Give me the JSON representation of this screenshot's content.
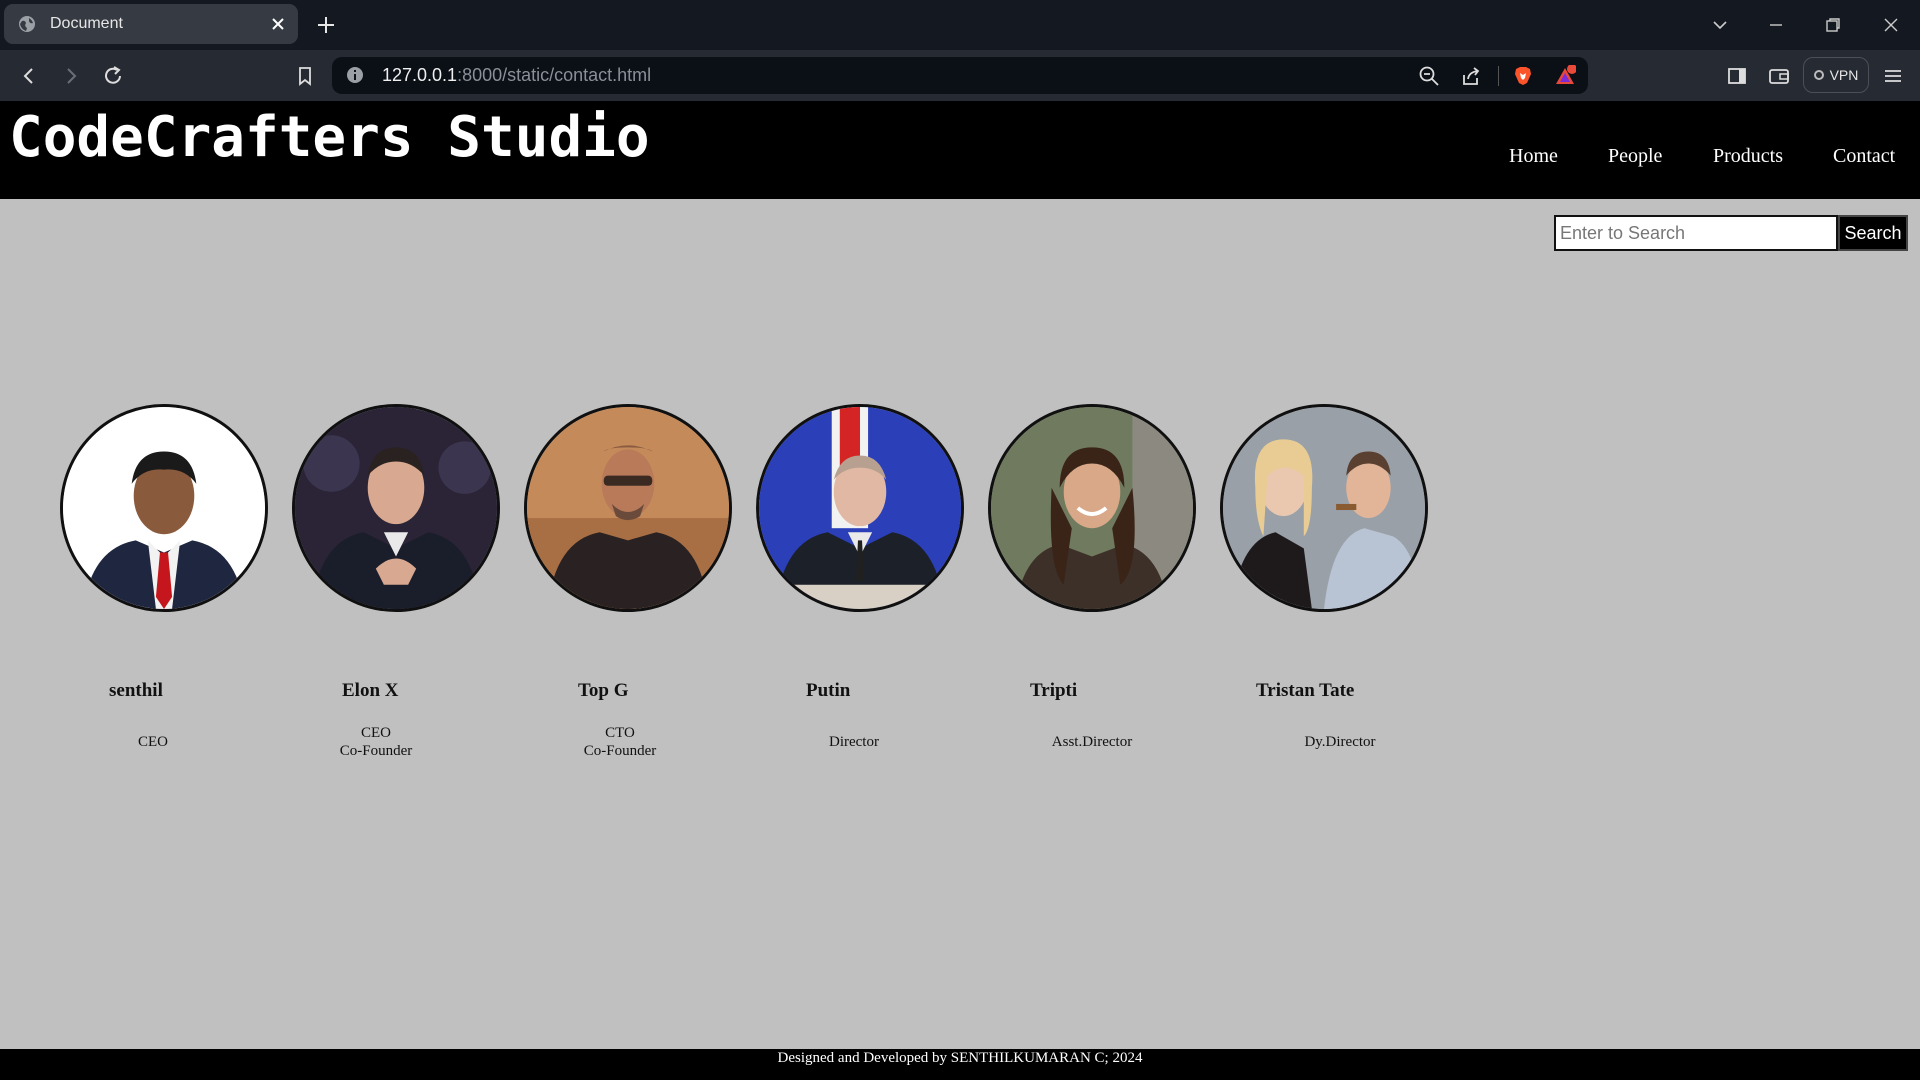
{
  "browser": {
    "tab_title": "Document",
    "url_host": "127.0.0.1",
    "url_rest": ":8000/static/contact.html",
    "vpn_label": "VPN",
    "notification_count": "1"
  },
  "site": {
    "brand": "CodeCrafters Studio",
    "nav": [
      "Home",
      "People",
      "Products",
      "Contact"
    ]
  },
  "search": {
    "placeholder": "Enter to Search",
    "button_label": "Search"
  },
  "people": [
    {
      "name": "senthil",
      "roles": [
        "CEO"
      ],
      "icon": "person-photo",
      "bg": "#ffffff"
    },
    {
      "name": "Elon X",
      "roles": [
        "CEO",
        "Co-Founder"
      ],
      "icon": "person-photo",
      "bg": "#2a2436"
    },
    {
      "name": "Top G",
      "roles": [
        "CTO",
        "Co-Founder"
      ],
      "icon": "person-photo",
      "bg": "#c48a5a"
    },
    {
      "name": "Putin",
      "roles": [
        "Director"
      ],
      "icon": "person-photo",
      "bg": "#2b3fb8"
    },
    {
      "name": "Tripti",
      "roles": [
        "Asst.Director"
      ],
      "icon": "person-photo",
      "bg": "#6f7a5e"
    },
    {
      "name": "Tristan Tate",
      "roles": [
        "Dy.Director"
      ],
      "icon": "person-photo",
      "bg": "#9aa0a8"
    }
  ],
  "footer": {
    "text": "Designed and Developed by SENTHILKUMARAN C; 2024"
  }
}
